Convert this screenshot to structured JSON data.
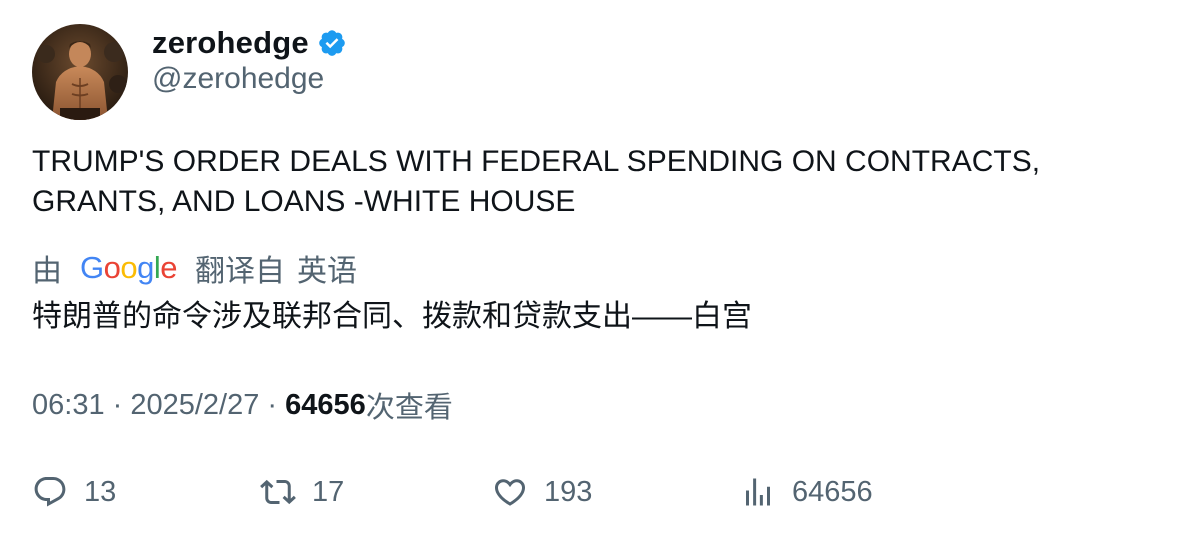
{
  "user": {
    "display_name": "zerohedge",
    "handle": "@zerohedge",
    "verified": true,
    "verified_color": "#1d9bf0"
  },
  "tweet": {
    "text_line1": "TRUMP'S ORDER DEALS WITH FEDERAL SPENDING ON CONTRACTS,",
    "text_line2": "GRANTS, AND LOANS -WHITE HOUSE"
  },
  "translation": {
    "prefix": "由",
    "provider": "Google",
    "translated_from": "翻译自",
    "language": "英语",
    "text": "特朗普的命令涉及联邦合同、拨款和贷款支出——白宫"
  },
  "meta": {
    "time": "06:31",
    "separator": " · ",
    "date": "2025/2/27",
    "views": "64656",
    "views_label": "次查看"
  },
  "actions": {
    "replies": "13",
    "retweets": "17",
    "likes": "193",
    "views": "64656"
  }
}
